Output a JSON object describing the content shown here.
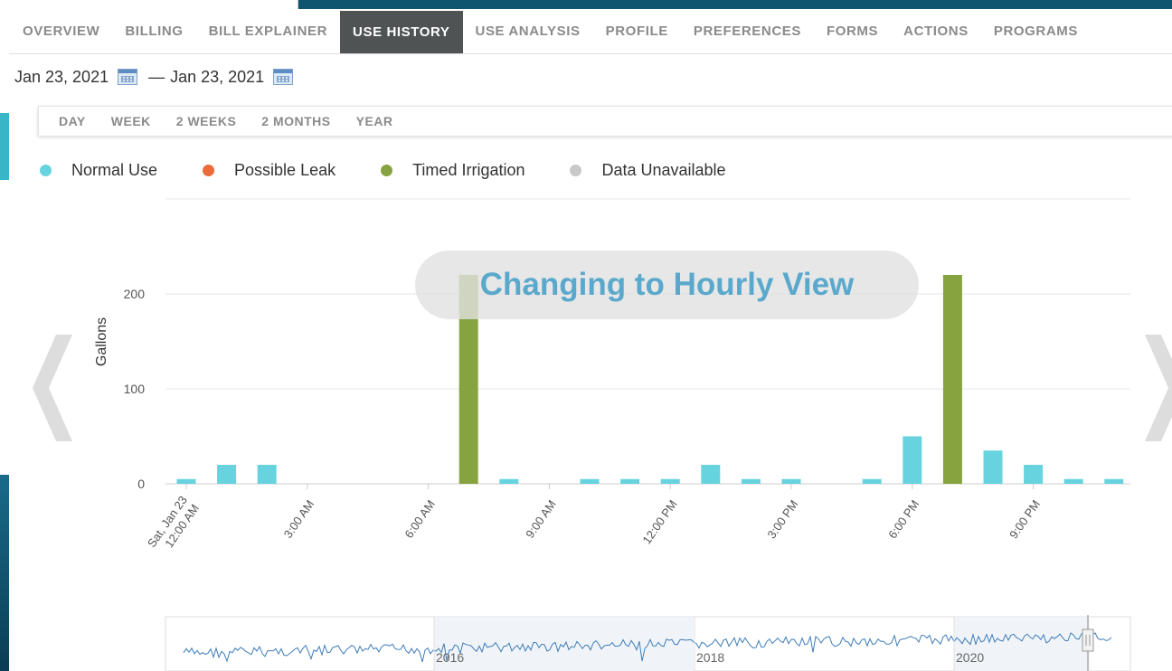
{
  "nav": {
    "items": [
      {
        "label": "OVERVIEW",
        "active": false
      },
      {
        "label": "BILLING",
        "active": false
      },
      {
        "label": "BILL EXPLAINER",
        "active": false
      },
      {
        "label": "USE HISTORY",
        "active": true
      },
      {
        "label": "USE ANALYSIS",
        "active": false
      },
      {
        "label": "PROFILE",
        "active": false
      },
      {
        "label": "PREFERENCES",
        "active": false
      },
      {
        "label": "FORMS",
        "active": false
      },
      {
        "label": "ACTIONS",
        "active": false
      },
      {
        "label": "PROGRAMS",
        "active": false
      }
    ]
  },
  "date_range": {
    "start": "Jan 23, 2021",
    "separator": "—",
    "end": "Jan 23, 2021"
  },
  "range_buttons": [
    "DAY",
    "WEEK",
    "2 WEEKS",
    "2 MONTHS",
    "YEAR"
  ],
  "legend": [
    {
      "label": "Normal Use",
      "color": "#66d3de"
    },
    {
      "label": "Possible Leak",
      "color": "#eb6b3a"
    },
    {
      "label": "Timed Irrigation",
      "color": "#86a33f"
    },
    {
      "label": "Data Unavailable",
      "color": "#c8c8c8"
    }
  ],
  "overlay": {
    "text": "Changing to Hourly View"
  },
  "colors": {
    "normal": "#66d3de",
    "irrigation": "#86a33f",
    "leak": "#eb6b3a",
    "unavailable": "#c8c8c8",
    "navigator_line": "#3e7cb8"
  },
  "chart_data": {
    "type": "bar",
    "ylabel": "Gallons",
    "ylim": [
      0,
      240
    ],
    "yticks": [
      0,
      100,
      200
    ],
    "grid": true,
    "x_tick_labels": [
      {
        "hour": 0,
        "lines": [
          "Sat, Jan 23",
          "12:00 AM"
        ]
      },
      {
        "hour": 3,
        "lines": [
          "3:00 AM"
        ]
      },
      {
        "hour": 6,
        "lines": [
          "6:00 AM"
        ]
      },
      {
        "hour": 9,
        "lines": [
          "9:00 AM"
        ]
      },
      {
        "hour": 12,
        "lines": [
          "12:00 PM"
        ]
      },
      {
        "hour": 15,
        "lines": [
          "3:00 PM"
        ]
      },
      {
        "hour": 18,
        "lines": [
          "6:00 PM"
        ]
      },
      {
        "hour": 21,
        "lines": [
          "9:00 PM"
        ]
      }
    ],
    "series": [
      {
        "name": "Normal Use",
        "color": "#66d3de",
        "values": [
          5,
          20,
          20,
          0,
          0,
          0,
          0,
          0,
          5,
          0,
          5,
          5,
          5,
          20,
          5,
          5,
          0,
          5,
          50,
          0,
          35,
          20,
          5,
          5
        ]
      },
      {
        "name": "Timed Irrigation",
        "color": "#86a33f",
        "values": [
          0,
          0,
          0,
          0,
          0,
          0,
          0,
          220,
          0,
          0,
          0,
          0,
          0,
          0,
          0,
          0,
          0,
          0,
          0,
          220,
          0,
          0,
          0,
          0
        ]
      }
    ],
    "navigator": {
      "year_labels": [
        "2016",
        "2018",
        "2020"
      ],
      "selection": "Jan 23, 2021"
    }
  }
}
